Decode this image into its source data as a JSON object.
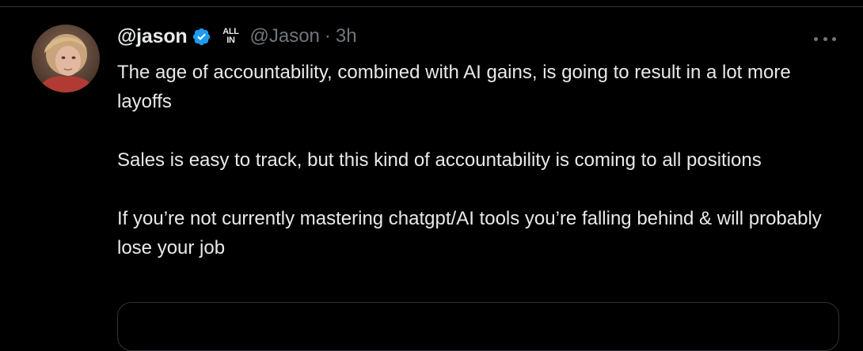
{
  "tweet": {
    "display_name": "@jason",
    "verified": true,
    "affiliate_badge_lines": [
      "ALL",
      "IN"
    ],
    "handle": "@Jason",
    "separator": "·",
    "timestamp": "3h",
    "paragraphs": [
      "The age of accountability, combined with AI gains, is going to result in a lot more layoffs",
      "Sales is easy to track, but this kind of accountability is coming to all positions",
      "If you’re not currently mastering chatgpt/AI tools you’re falling behind & will probably lose your job"
    ]
  },
  "icons": {
    "avatar": "avatar",
    "verified": "verified-badge-icon",
    "affiliate": "all-in-affiliate-icon",
    "more": "more-options-icon"
  },
  "colors": {
    "background": "#000000",
    "text_primary": "#e7e9ea",
    "text_secondary": "#71767b",
    "verified_blue": "#1d9bf0",
    "border": "#2f3336"
  }
}
